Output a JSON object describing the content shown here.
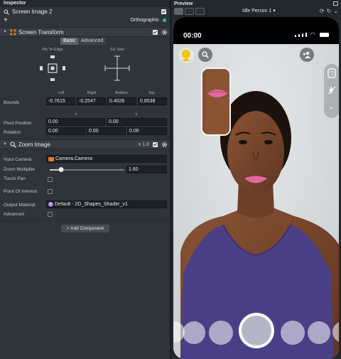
{
  "inspector": {
    "title": "Inspector",
    "object_name": "Screen Image 2",
    "add_symbol": "+",
    "camera_mode": "Orthographic",
    "screen_transform": {
      "title": "Screen Transform",
      "tabs": [
        "Basic",
        "Advanced"
      ],
      "active_tab": "Basic",
      "pin_to_edge": "Pin To Edge",
      "fix_size": "Fix Size",
      "bounds_label": "Bounds",
      "bounds_headers": [
        "Left",
        "Right",
        "Bottom",
        "Top"
      ],
      "bounds_values": [
        "-0.7615",
        "-0.2547",
        "0.4026",
        "0.8538"
      ],
      "x_label": "x",
      "y_label": "y",
      "pivot_label": "Pivot Position",
      "pivot_values": [
        "0.00",
        "0.00"
      ],
      "rotation_label": "Rotation",
      "rotation_values": [
        "0.00",
        "0.00",
        "0.00"
      ]
    },
    "zoom_image": {
      "title": "Zoom Image",
      "version": "v 1.0",
      "input_camera_label": "Input Camera",
      "input_camera_value": "Camera.Camera",
      "zoom_multiplier_label": "Zoom Multiplier",
      "zoom_multiplier_value": "1.60",
      "zoom_slider_fraction": 0.15,
      "touch_pan_label": "Touch Pan",
      "point_of_interest_label": "Point Of Interest",
      "output_material_label": "Output Material",
      "output_material_value": "Default - 2D_Shapes_Shader_v1",
      "advanced_label": "Advanced"
    },
    "add_component": "+ Add Component"
  },
  "preview": {
    "title": "Preview",
    "preview_subject": "Idle Person 1 ▾",
    "status_time": "00:00"
  },
  "colors": {
    "accent_orange": "#e87b1e",
    "toggle_green": "#30c07a",
    "shirt": "#4a3f86",
    "background": "#d6dadc"
  }
}
